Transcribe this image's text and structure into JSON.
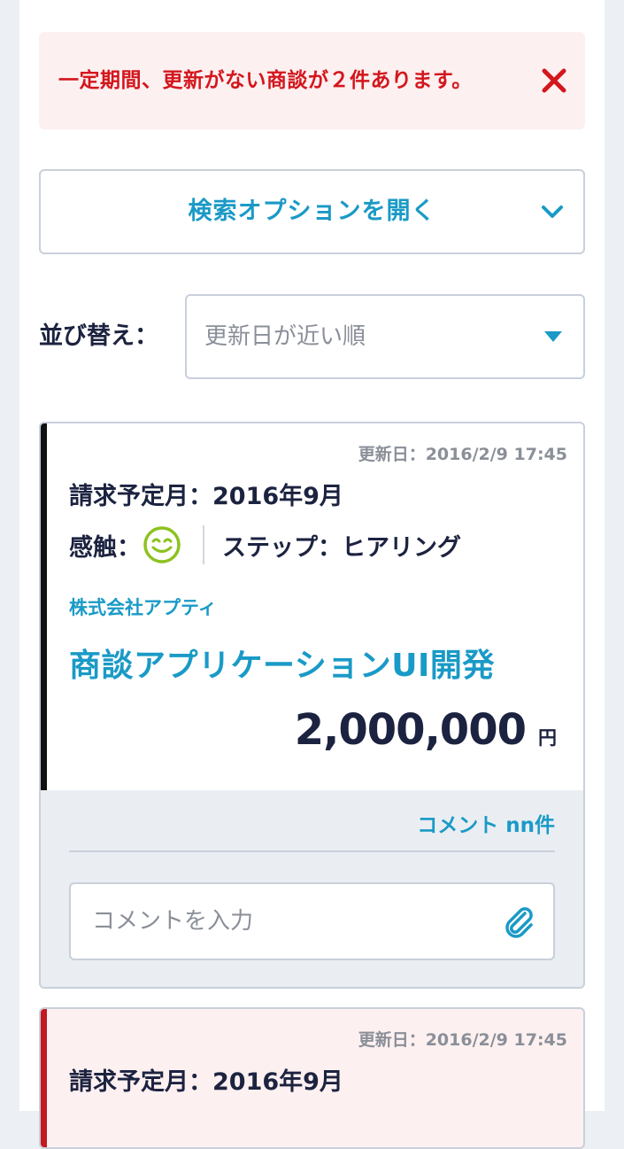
{
  "alert": {
    "message": "一定期間、更新がない商談が２件あります。",
    "close_icon": "close-icon",
    "color": "#d3161d",
    "background": "#fdf0f0"
  },
  "search": {
    "toggle_label": "検索オプションを開く",
    "chevron_icon": "chevron-down-icon"
  },
  "sort": {
    "label": "並び替え：",
    "selected": "更新日が近い順",
    "caret_icon": "caret-down-icon"
  },
  "deals": [
    {
      "updated": "更新日：2016/2/9 17:45",
      "billing": "請求予定月：2016年9月",
      "feel_label": "感触：",
      "feel_icon": "smiley-icon",
      "step": "ステップ：ヒアリング",
      "company": "株式会社アプティ",
      "name": "商談アプリケーションUI開発",
      "amount": "2,000,000",
      "currency": "円",
      "comments": "コメント nn件",
      "comment_placeholder": "コメントを入力",
      "attach_icon": "paperclip-icon",
      "accent_color": "#111111"
    },
    {
      "updated": "更新日：2016/2/9 17:45",
      "billing": "請求予定月：2016年9月",
      "accent_color": "#c11a22"
    }
  ],
  "colors": {
    "accent_blue": "#1a9ac6",
    "text_dark": "#1c2340",
    "muted": "#8a8f98",
    "smiley_green": "#8dc21f"
  }
}
